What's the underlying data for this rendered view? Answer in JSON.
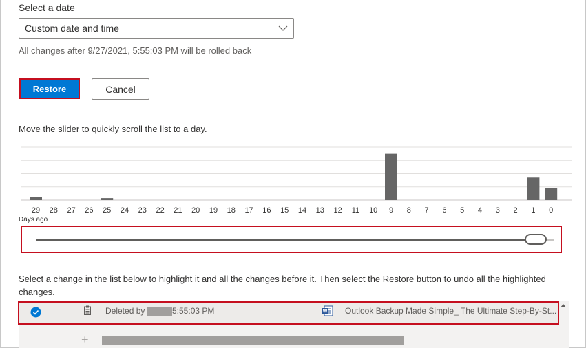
{
  "date_section": {
    "label": "Select a date",
    "dropdown_value": "Custom date and time",
    "rollback_note": "All changes after 9/27/2021, 5:55:03 PM will be rolled back"
  },
  "actions": {
    "restore_label": "Restore",
    "cancel_label": "Cancel"
  },
  "slider": {
    "hint": "Move the slider to quickly scroll the list to a day.",
    "axis_caption": "Days ago",
    "position_days_ago": 0
  },
  "chart_data": {
    "type": "bar",
    "categories": [
      "29",
      "28",
      "27",
      "26",
      "25",
      "24",
      "23",
      "22",
      "21",
      "20",
      "19",
      "18",
      "17",
      "16",
      "15",
      "14",
      "13",
      "12",
      "11",
      "10",
      "9",
      "8",
      "7",
      "6",
      "5",
      "4",
      "3",
      "2",
      "1",
      "0"
    ],
    "values": [
      0.25,
      0,
      0,
      0,
      0.15,
      0,
      0,
      0,
      0,
      0,
      0,
      0,
      0,
      0,
      0,
      0,
      0,
      0,
      0,
      0,
      3.5,
      0,
      0,
      0,
      0,
      0,
      0,
      0,
      1.7,
      0.9
    ],
    "xlabel": "Days ago",
    "ylim": [
      0,
      4
    ],
    "grid": true,
    "bar_color": "#666666"
  },
  "instructions": "Select a change in the list below to highlight it and all the changes before it. Then select the Restore button to undo all the highlighted changes.",
  "changes": [
    {
      "action_prefix": "Deleted by",
      "time": "5:55:03 PM",
      "file_name": "Outlook Backup Made Simple_ The Ultimate Step-By-St...",
      "icon": "word-icon",
      "selected": true
    }
  ],
  "colors": {
    "accent": "#0078d4",
    "highlight_border": "#c50f1f"
  }
}
